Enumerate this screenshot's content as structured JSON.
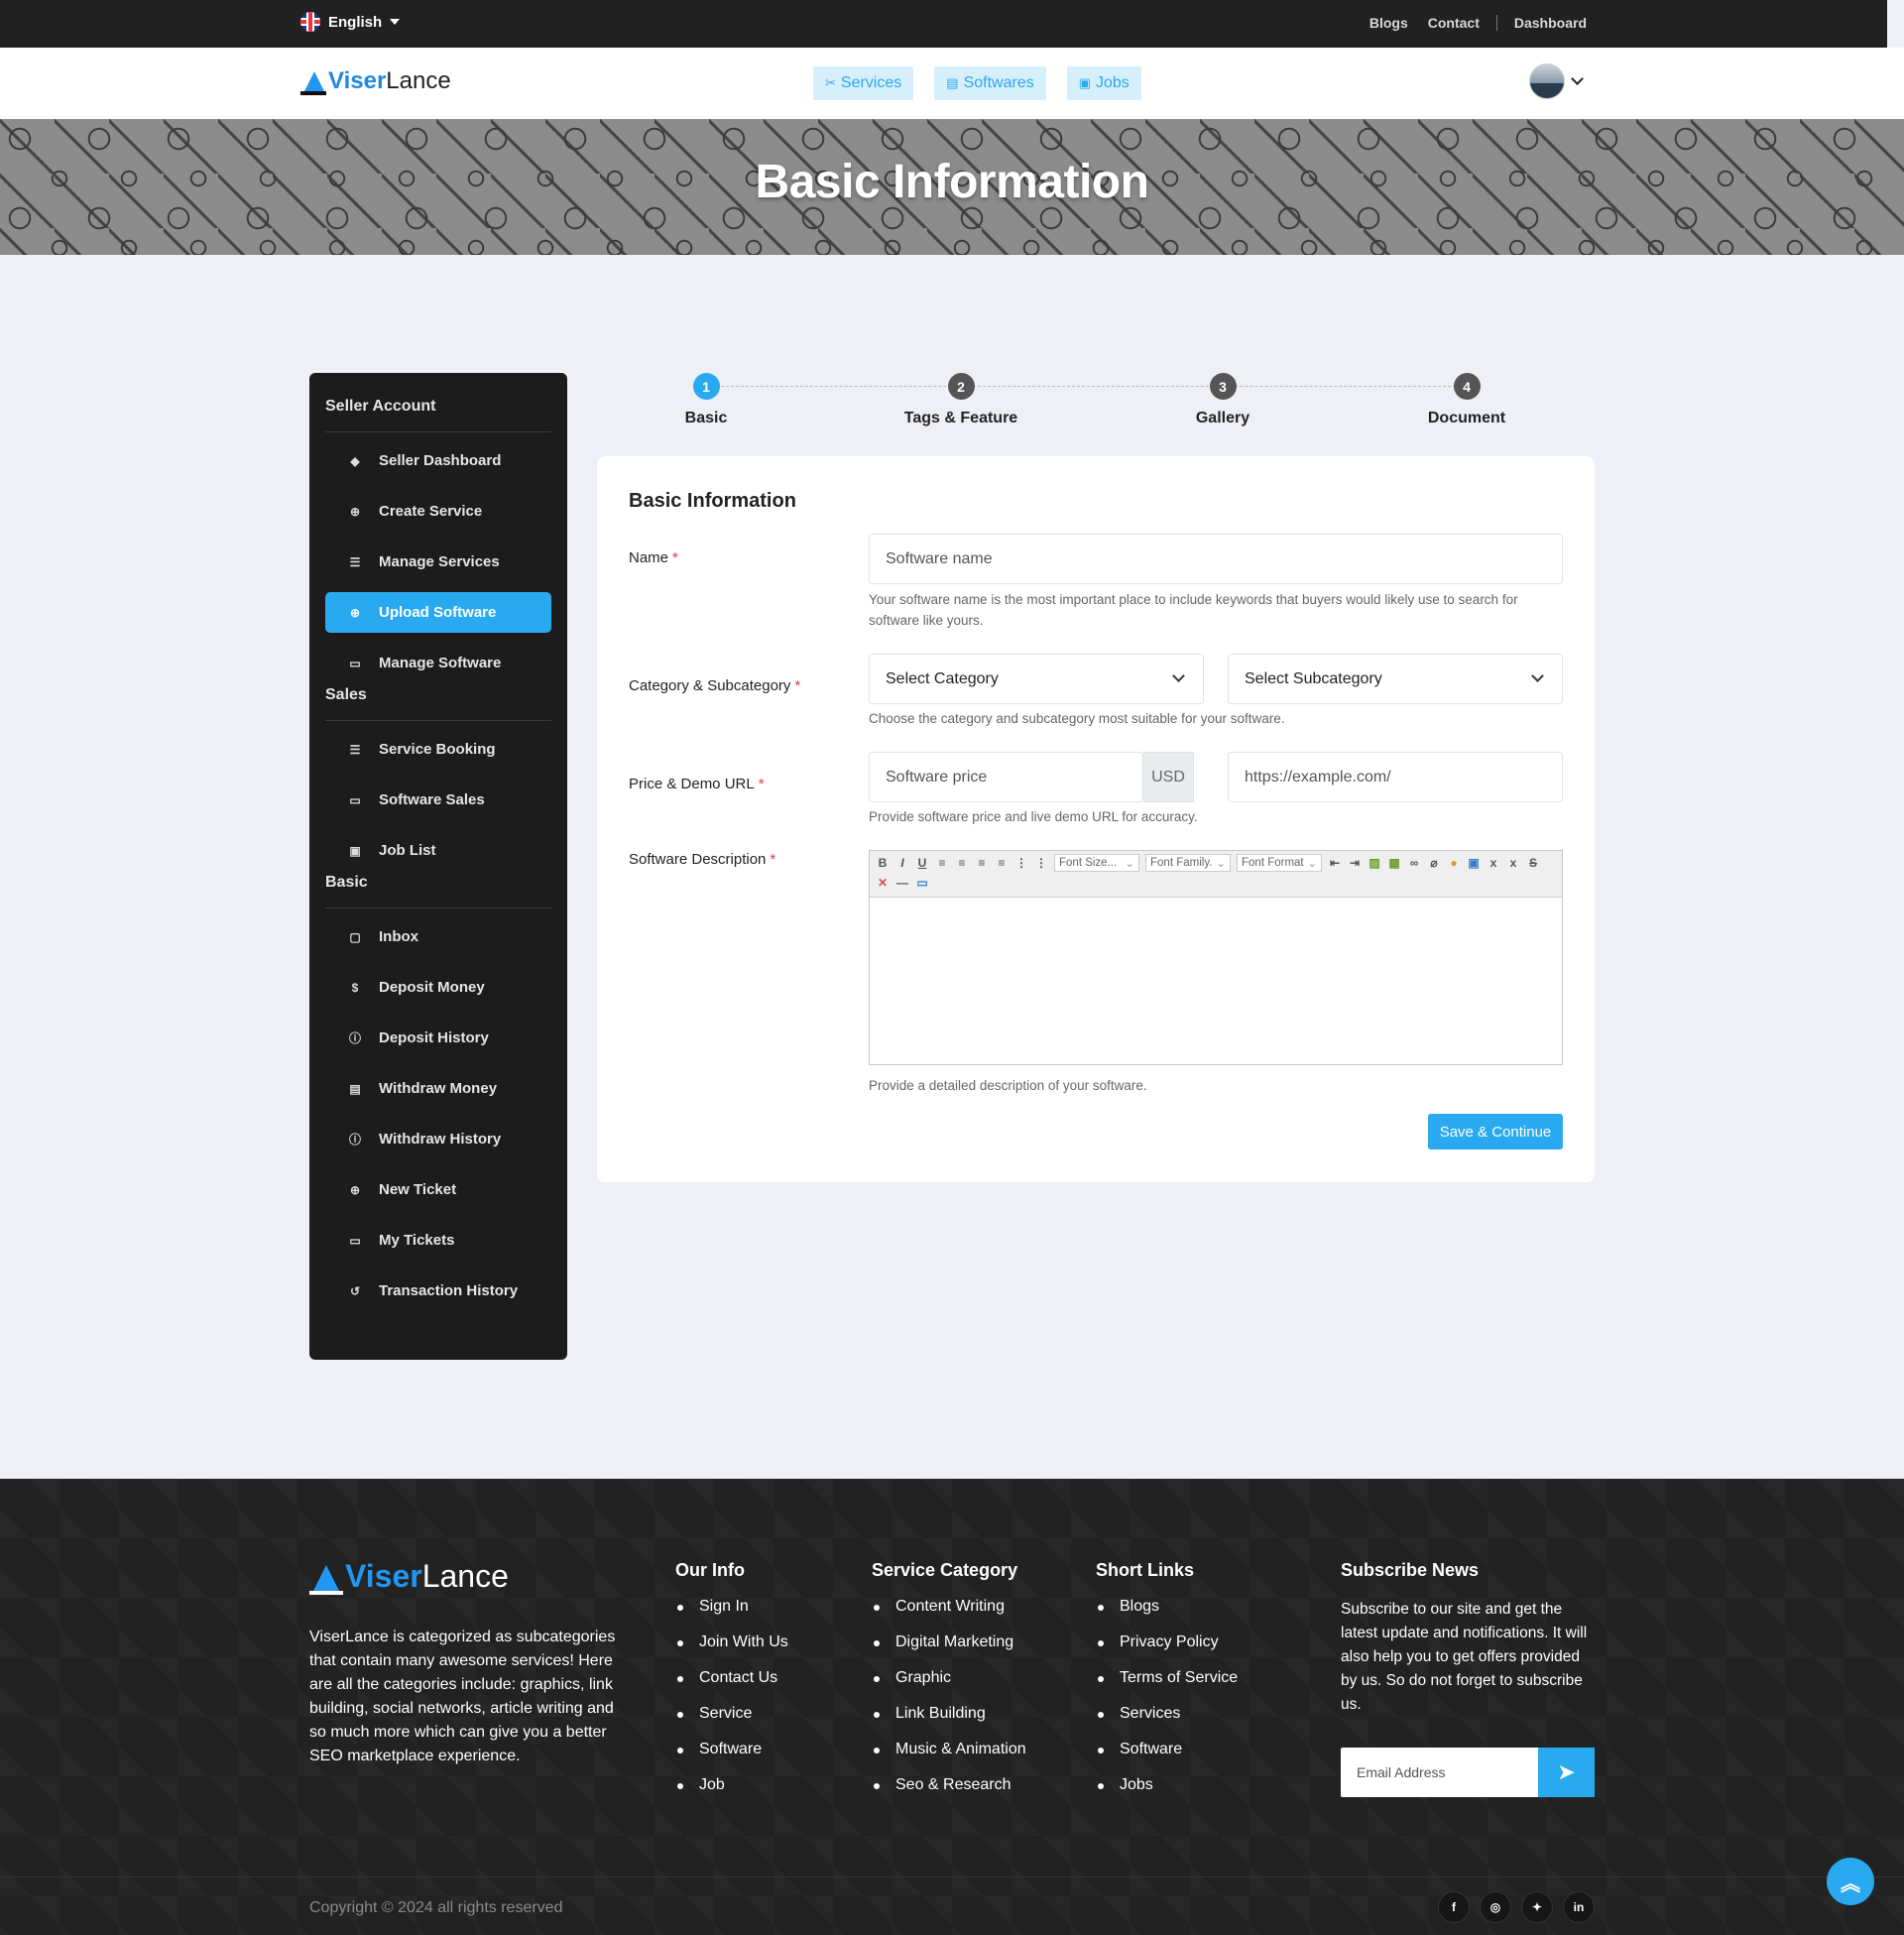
{
  "topbar": {
    "language": "English",
    "links": [
      "Blogs",
      "Contact",
      "Dashboard"
    ]
  },
  "header": {
    "logo_part1": "Viser",
    "logo_part2": "Lance",
    "nav": [
      {
        "label": "Services",
        "icon": "tools-icon"
      },
      {
        "label": "Softwares",
        "icon": "software-icon"
      },
      {
        "label": "Jobs",
        "icon": "briefcase-icon"
      }
    ]
  },
  "banner": {
    "title": "Basic Information"
  },
  "sidebar": {
    "sections": [
      {
        "title": "Seller Account",
        "items": [
          "Seller Dashboard",
          "Create Service",
          "Manage Services",
          "Upload Software",
          "Manage Software"
        ]
      },
      {
        "title": "Sales",
        "items": [
          "Service Booking",
          "Software Sales",
          "Job List"
        ]
      },
      {
        "title": "Basic",
        "items": [
          "Inbox",
          "Deposit Money",
          "Deposit History",
          "Withdraw Money",
          "Withdraw History",
          "New Ticket",
          "My Tickets",
          "Transaction History"
        ]
      }
    ],
    "active_item": "Upload Software"
  },
  "stepper": {
    "steps": [
      {
        "num": "1",
        "label": "Basic"
      },
      {
        "num": "2",
        "label": "Tags & Feature"
      },
      {
        "num": "3",
        "label": "Gallery"
      },
      {
        "num": "4",
        "label": "Document"
      }
    ],
    "active": 1
  },
  "form": {
    "title": "Basic Information",
    "name_label": "Name",
    "name_placeholder": "Software name",
    "name_help": "Your software name is the most important place to include keywords that buyers would likely use to search for software like yours.",
    "category_label": "Category & Subcategory",
    "category_value": "Select Category",
    "subcategory_value": "Select Subcategory",
    "category_help": "Choose the category and subcategory most suitable for your software.",
    "price_label": "Price & Demo URL",
    "price_placeholder": "Software price",
    "currency": "USD",
    "demo_placeholder": "https://example.com/",
    "price_help": "Provide software price and live demo URL for accuracy.",
    "description_label": "Software Description",
    "editor_dropdowns": [
      "Font Size...",
      "Font Family.",
      "Font Format"
    ],
    "description_help": "Provide a detailed description of your software.",
    "required_mark": "*",
    "submit": "Save & Continue"
  },
  "footer": {
    "logo_part1": "Viser",
    "logo_part2": "Lance",
    "about": "ViserLance is categorized as subcategories that contain many awesome services! Here are all the categories include: graphics, link building, social networks, article writing and so much more which can give you a better SEO marketplace experience.",
    "columns": [
      {
        "title": "Our Info",
        "links": [
          "Sign In",
          "Join With Us",
          "Contact Us",
          "Service",
          "Software",
          "Job"
        ]
      },
      {
        "title": "Service Category",
        "links": [
          "Content Writing",
          "Digital Marketing",
          "Graphic",
          "Link Building",
          "Music & Animation",
          "Seo & Research"
        ]
      },
      {
        "title": "Short Links",
        "links": [
          "Blogs",
          "Privacy Policy",
          "Terms of Service",
          "Services",
          "Software",
          "Jobs"
        ]
      }
    ],
    "subscribe_title": "Subscribe News",
    "subscribe_text": "Subscribe to our site and get the latest update and notifications. It will also help you to get offers provided by us. So do not forget to subscribe us.",
    "email_placeholder": "Email Address",
    "copyright": "Copyright © 2024 all rights reserved",
    "socials": [
      "facebook-icon",
      "instagram-icon",
      "twitter-icon",
      "linkedin-icon"
    ]
  },
  "colors": {
    "accent": "#29a9f0",
    "dark": "#1c1c1c",
    "background": "#eff0f5"
  }
}
